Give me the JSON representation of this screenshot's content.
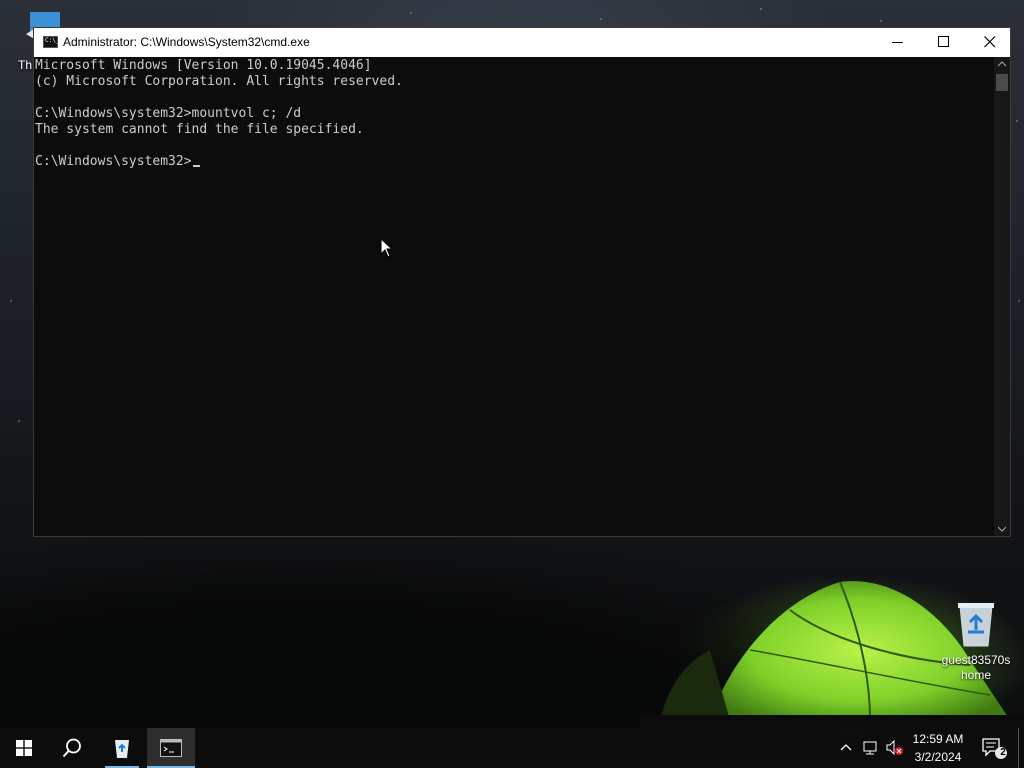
{
  "desktop": {
    "left_icon_label": "Th",
    "recycle_bin_label_line1": "guest83570s",
    "recycle_bin_label_line2": "home"
  },
  "window": {
    "title": "Administrator: C:\\Windows\\System32\\cmd.exe",
    "icon_text": "C:\\_"
  },
  "console": {
    "lines": [
      "Microsoft Windows [Version 10.0.19045.4046]",
      "(c) Microsoft Corporation. All rights reserved.",
      "",
      "C:\\Windows\\system32>mountvol c; /d",
      "The system cannot find the file specified.",
      "",
      "C:\\Windows\\system32>"
    ]
  },
  "taskbar": {
    "clock_time": "12:59 AM",
    "clock_date": "3/2/2024",
    "notification_count": "2",
    "accent_color": "#76b9ed"
  }
}
